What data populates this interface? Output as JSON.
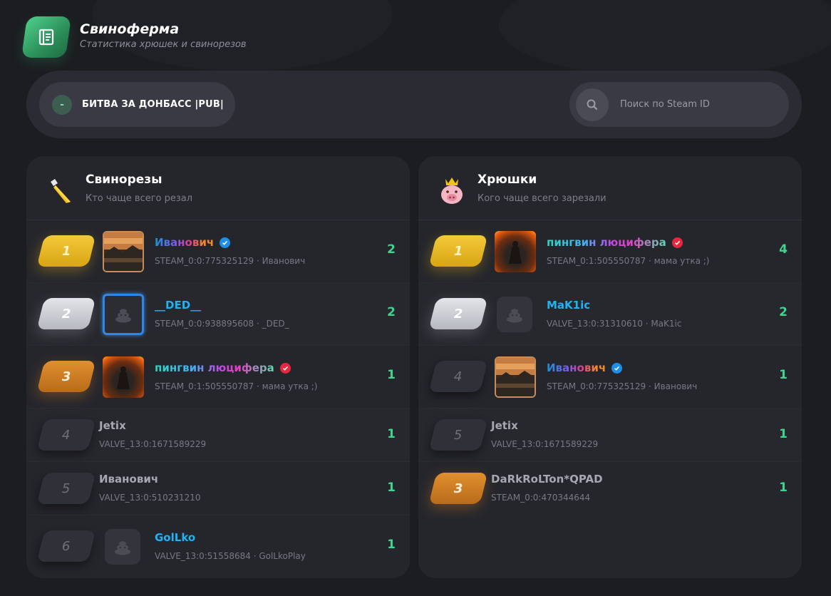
{
  "app": {
    "title": "Свиноферма",
    "subtitle": "Статистика хрюшек и свинорезов"
  },
  "toolbar": {
    "server_toggle": "-",
    "server_name": "БИТВА ЗА ДОНБАСС |PUB|",
    "search_placeholder": "Поиск по Steam ID"
  },
  "killers": {
    "title": "Свинорезы",
    "subtitle": "Кто чаще всего резал",
    "icon": "knife-icon",
    "rows": [
      {
        "rank": "1",
        "name": "Иванович",
        "steam": "STEAM_0:0:775325129 · Иванович",
        "count": "2",
        "badge": "verified-blue"
      },
      {
        "rank": "2",
        "name": "__DED__",
        "steam": "STEAM_0:0:938895608 · _DED_",
        "count": "2"
      },
      {
        "rank": "3",
        "name": "пингвин люцифера",
        "steam": "STEAM_0:1:505550787 · мама утка ;)",
        "count": "1",
        "badge": "verified-red"
      },
      {
        "rank": "4",
        "name": "Jetix",
        "steam": "VALVE_13:0:1671589229",
        "count": "1"
      },
      {
        "rank": "5",
        "name": "Иванович",
        "steam": "VALVE_13:0:510231210",
        "count": "1"
      },
      {
        "rank": "6",
        "name": "GolLko",
        "steam": "VALVE_13:0:51558684 · GolLkoPlay",
        "count": "1"
      }
    ]
  },
  "victims": {
    "title": "Хрюшки",
    "subtitle": "Кого чаще всего зарезали",
    "icon": "crowned-pig-icon",
    "rows": [
      {
        "rank": "1",
        "name": "пингвин люцифера",
        "steam": "STEAM_0:1:505550787 · мама утка ;)",
        "count": "4",
        "badge": "verified-red"
      },
      {
        "rank": "2",
        "name": "MaK1ic",
        "steam": "VALVE_13:0:31310610 · MaK1ic",
        "count": "2"
      },
      {
        "rank": "4",
        "name": "Иванович",
        "steam": "STEAM_0:0:775325129 · Иванович",
        "count": "1",
        "badge": "verified-blue"
      },
      {
        "rank": "5",
        "name": "Jetix",
        "steam": "VALVE_13:0:1671589229",
        "count": "1"
      },
      {
        "rank": "3",
        "name": "DaRkRoLTon*QPAD",
        "steam": "STEAM_0:0:470344644",
        "count": "1"
      }
    ]
  },
  "colors": {
    "accent_green": "#3ed68d",
    "gold": "#f2c93a",
    "silver": "#d4d6dc",
    "bronze": "#d8842a",
    "background": "#1c1d21",
    "panel": "#25262c"
  }
}
